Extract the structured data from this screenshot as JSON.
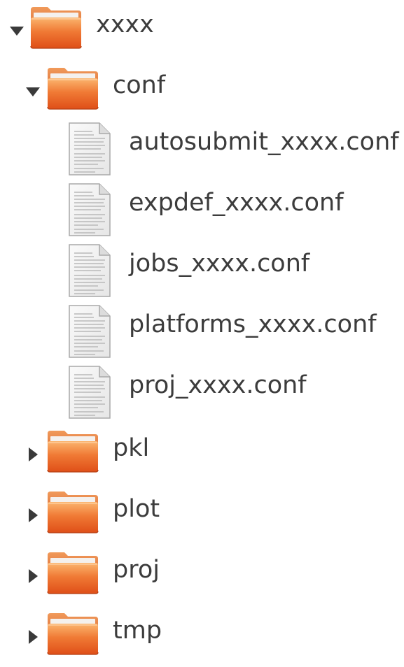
{
  "tree": {
    "root": {
      "label": "xxxx",
      "icon": "folder-icon",
      "expanded": true
    },
    "conf": {
      "label": "conf",
      "icon": "folder-icon",
      "expanded": true,
      "files": [
        {
          "label": "autosubmit_xxxx.conf",
          "icon": "text-file-icon"
        },
        {
          "label": "expdef_xxxx.conf",
          "icon": "text-file-icon"
        },
        {
          "label": "jobs_xxxx.conf",
          "icon": "text-file-icon"
        },
        {
          "label": "platforms_xxxx.conf",
          "icon": "text-file-icon"
        },
        {
          "label": "proj_xxxx.conf",
          "icon": "text-file-icon"
        }
      ]
    },
    "folders": [
      {
        "label": "pkl",
        "icon": "folder-icon",
        "expanded": false
      },
      {
        "label": "plot",
        "icon": "folder-icon",
        "expanded": false
      },
      {
        "label": "proj",
        "icon": "folder-icon",
        "expanded": false
      },
      {
        "label": "tmp",
        "icon": "folder-icon",
        "expanded": false
      }
    ]
  },
  "colors": {
    "folder_orange": "#e8581d",
    "folder_light": "#f9a85e",
    "text": "#3c3c3c",
    "expander": "#3a3a3a"
  }
}
